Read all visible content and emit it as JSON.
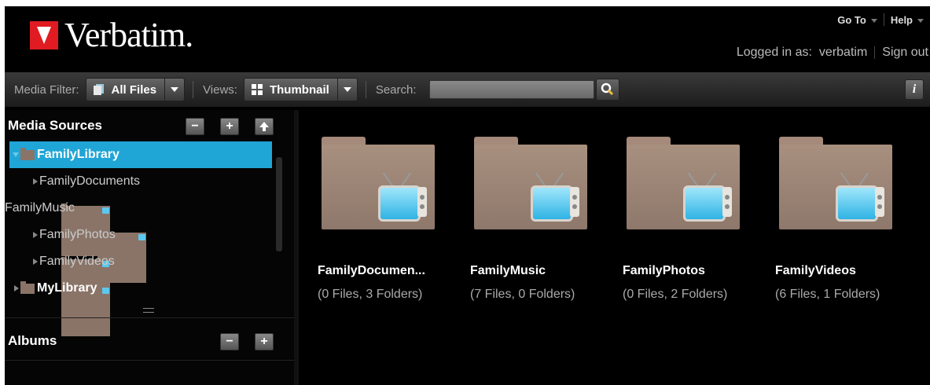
{
  "brand": {
    "name": "Verbatim.",
    "accent": "#e01b22"
  },
  "header": {
    "goto_label": "Go To",
    "help_label": "Help",
    "logged_in_label": "Logged in as:",
    "username": "verbatim",
    "signout_label": "Sign out"
  },
  "toolbar": {
    "media_filter_label": "Media Filter:",
    "media_filter_value": "All Files",
    "views_label": "Views:",
    "views_value": "Thumbnail",
    "search_label": "Search:",
    "search_value": "",
    "info_label": "i"
  },
  "sidebar": {
    "media_sources_title": "Media Sources",
    "albums_title": "Albums",
    "selected_color": "#1fa5d6",
    "tree": [
      {
        "label": "FamilyLibrary",
        "expanded": true,
        "selected": true
      },
      {
        "label": "FamilyDocuments",
        "expandable": true
      },
      {
        "label": "FamilyMusic",
        "expandable": false
      },
      {
        "label": "FamilyPhotos",
        "expandable": true
      },
      {
        "label": "FamilyVideos",
        "expandable": true
      },
      {
        "label": "MyLibrary",
        "expandable": true
      }
    ]
  },
  "content": {
    "items": [
      {
        "name": "FamilyDocumen...",
        "meta": "(0 Files, 3 Folders)",
        "icon": "media-folder-tv-icon"
      },
      {
        "name": "FamilyMusic",
        "meta": "(7 Files, 0 Folders)",
        "icon": "media-folder-tv-icon"
      },
      {
        "name": "FamilyPhotos",
        "meta": "(0 Files, 2 Folders)",
        "icon": "media-folder-tv-icon"
      },
      {
        "name": "FamilyVideos",
        "meta": "(6 Files, 1 Folders)",
        "icon": "media-folder-tv-icon"
      }
    ]
  }
}
